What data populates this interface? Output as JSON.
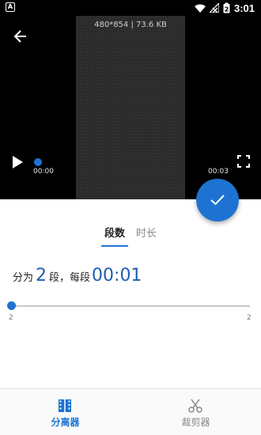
{
  "status_bar": {
    "time": "3:01",
    "battery": "2"
  },
  "video": {
    "meta": "480*854 | 73.6 KB",
    "current_time": "00:00",
    "end_time": "00:03"
  },
  "tabs": [
    {
      "label": "段数",
      "active": true
    },
    {
      "label": "时长",
      "active": false
    }
  ],
  "segment": {
    "prefix": "分为",
    "count": "2",
    "middle": "段，每段",
    "duration": "00:01"
  },
  "slider": {
    "min_label": "2",
    "max_label": "2",
    "value": 2
  },
  "bottom_nav": [
    {
      "label": "分离器",
      "icon": "film-split-icon",
      "active": true
    },
    {
      "label": "裁剪器",
      "icon": "scissors-icon",
      "active": false
    }
  ],
  "colors": {
    "accent": "#1e73d2",
    "video_bg": "#000000"
  }
}
